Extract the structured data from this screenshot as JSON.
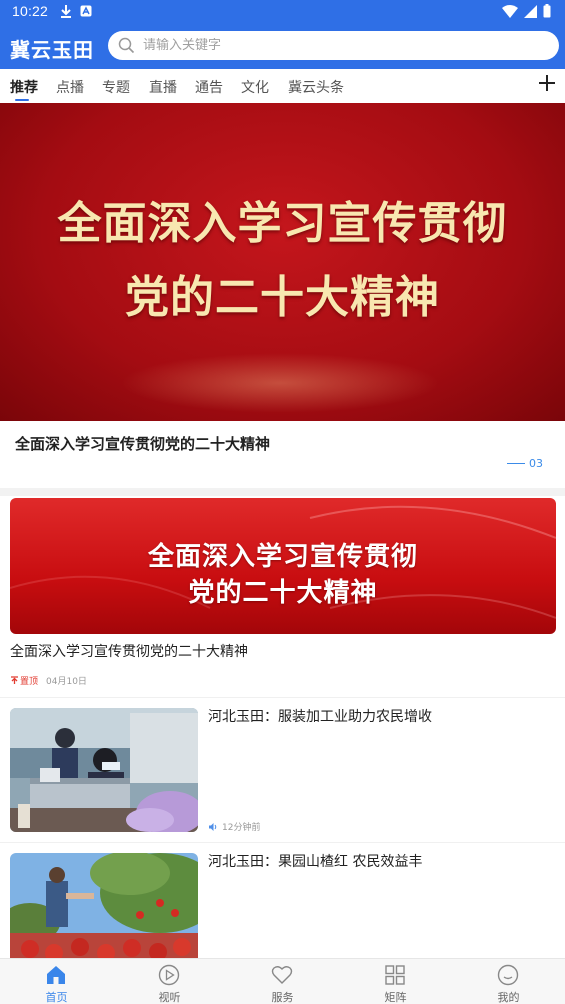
{
  "status_bar": {
    "time": "10:22"
  },
  "header": {
    "brand": "冀云玉田",
    "search_placeholder": "请输入关键字"
  },
  "tabs": [
    {
      "label": "推荐",
      "active": true
    },
    {
      "label": "点播"
    },
    {
      "label": "专题"
    },
    {
      "label": "直播"
    },
    {
      "label": "通告"
    },
    {
      "label": "文化"
    },
    {
      "label": "冀云头条"
    }
  ],
  "hero": {
    "image_line1": "全面深入学习宣传贯彻",
    "image_line2": "党的二十大精神",
    "caption": "全面深入学习宣传贯彻党的二十大精神",
    "page_indicator": "03"
  },
  "feature": {
    "image_line1": "全面深入学习宣传贯彻",
    "image_line2": "党的二十大精神",
    "title": "全面深入学习宣传贯彻党的二十大精神",
    "pin_label": "置顶",
    "date": "04月10日"
  },
  "news": [
    {
      "title": "河北玉田：服装加工业助力农民增收",
      "time": "12分钟前",
      "thumb": "sewing-workshop"
    },
    {
      "title": "河北玉田：果园山楂红 农民效益丰",
      "time": "",
      "thumb": "hawthorn-orchard"
    }
  ],
  "bottom_nav": [
    {
      "label": "首页",
      "icon": "home-icon",
      "active": true
    },
    {
      "label": "视听",
      "icon": "play-icon"
    },
    {
      "label": "服务",
      "icon": "heart-icon"
    },
    {
      "label": "矩阵",
      "icon": "grid-icon"
    },
    {
      "label": "我的",
      "icon": "smile-icon"
    }
  ],
  "colors": {
    "primary": "#2f6fe6",
    "accent_blue": "#3a86ea",
    "banner_red": "#c4161c",
    "pin_red": "#e23a2f"
  }
}
